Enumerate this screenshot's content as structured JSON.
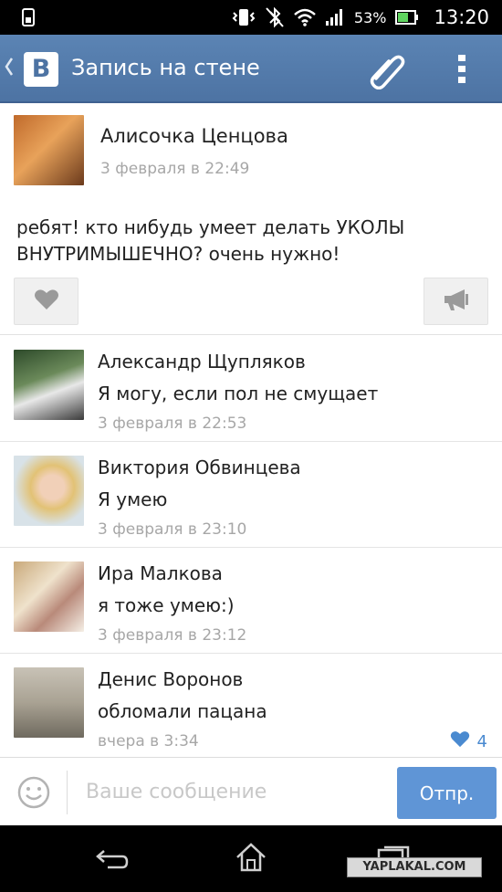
{
  "status_bar": {
    "battery_percent": "53%",
    "time": "13:20",
    "icons": [
      "sim-icon",
      "vibrate-icon",
      "bluetooth-off-icon",
      "wifi-icon",
      "signal-icon",
      "battery-icon"
    ]
  },
  "header": {
    "logo": "B",
    "title": "Запись на стене",
    "icons": [
      "back-chevron-icon",
      "attach-icon",
      "more-vert-icon"
    ]
  },
  "post": {
    "author": "Алисочка Ценцова",
    "date": "3 февраля в 22:49",
    "text": "ребят! кто нибудь умеет делать УКОЛЫ ВНУТРИМЫШЕЧНО? очень нужно!",
    "buttons": [
      "like-heart-icon",
      "share-megaphone-icon"
    ]
  },
  "comments": [
    {
      "name": "Александр Щупляков",
      "text": "Я могу, если пол не смущает",
      "date": "3 февраля в 22:53"
    },
    {
      "name": "Виктория Обвинцева",
      "text": "Я умею",
      "date": "3 февраля в 23:10"
    },
    {
      "name": "Ира Малкова",
      "text": "я тоже умею:)",
      "date": "3 февраля в 23:12"
    },
    {
      "name": "Денис Воронов",
      "text": "обломали пацана",
      "date": "вчера в 3:34",
      "likes": "4"
    }
  ],
  "compose": {
    "placeholder": "Ваше сообщение",
    "send_label": "Отпр."
  },
  "watermark": "YAPLAKAL.COM",
  "colors": {
    "header": "#5b84b4",
    "accent": "#5f95d6",
    "like_blue": "#4a8ad0",
    "date_gray": "#a7a7a7"
  }
}
